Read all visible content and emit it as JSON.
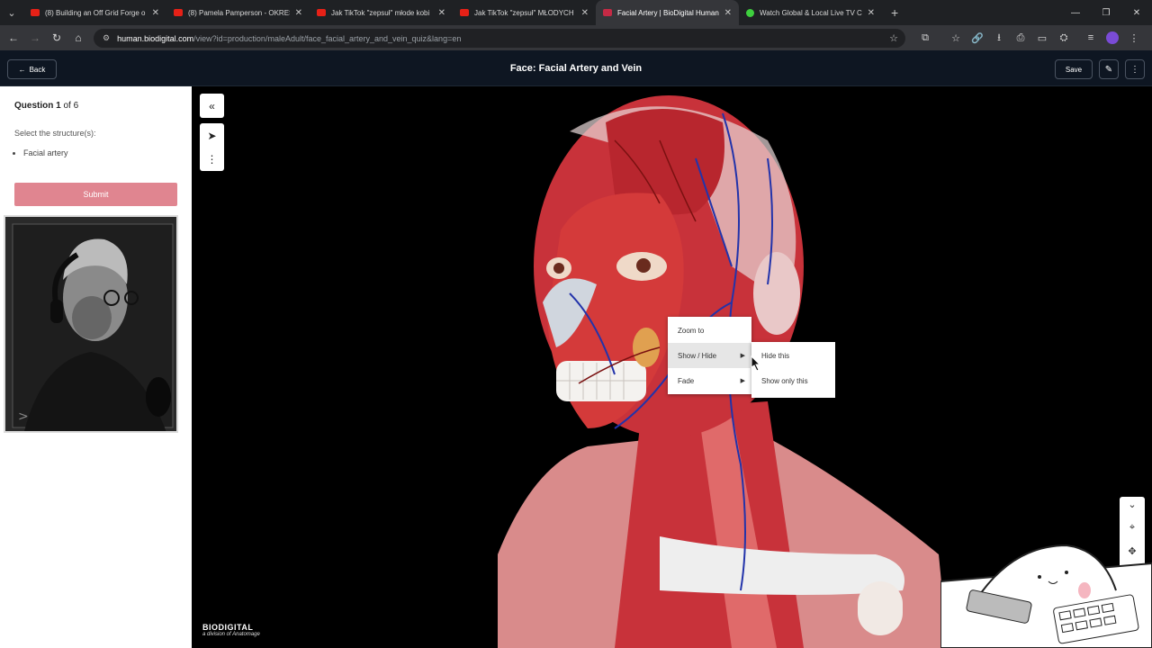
{
  "browser": {
    "tabs": [
      {
        "title": "(8) Building an Off Grid Forge o",
        "favicon": "youtube-icon",
        "active": false
      },
      {
        "title": "(8) Pamela Pamperson - OKRES",
        "favicon": "youtube-icon",
        "active": false
      },
      {
        "title": "Jak TikTok \"zepsuł\" młode kobi",
        "favicon": "youtube-icon",
        "active": false
      },
      {
        "title": "Jak TikTok \"zepsuł\" MŁODYCH f",
        "favicon": "youtube-icon",
        "active": false
      },
      {
        "title": "Facial Artery | BioDigital Human",
        "favicon": "biodigital-icon",
        "active": true
      },
      {
        "title": "Watch Global & Local Live TV C",
        "favicon": "tv-icon",
        "active": false
      }
    ],
    "url_host": "human.biodigital.com",
    "url_path": "/view?id=production/maleAdult/face_facial_artery_and_vein_quiz&lang=en"
  },
  "header": {
    "back_label": "Back",
    "title": "Face: Facial Artery and Vein",
    "save_label": "Save"
  },
  "quiz": {
    "question_word": "Question",
    "question_number": "1",
    "question_of": "of 6",
    "instruction": "Select the structure(s):",
    "items": [
      "Facial artery"
    ],
    "submit_label": "Submit",
    "submit_color": "#e08590"
  },
  "context_menu": {
    "items": [
      {
        "label": "Zoom to"
      },
      {
        "label": "Show / Hide",
        "highlighted": true
      },
      {
        "label": "Fade"
      }
    ],
    "submenu": [
      {
        "label": "Hide this"
      },
      {
        "label": "Show only this"
      }
    ]
  },
  "branding": {
    "logo_text": "BIODIGITAL",
    "logo_sub": "a division of Anatomage"
  },
  "colors": {
    "app_header_bg": "#0e1622",
    "muscle_red": "#c8323a",
    "vein_blue": "#2233aa"
  }
}
